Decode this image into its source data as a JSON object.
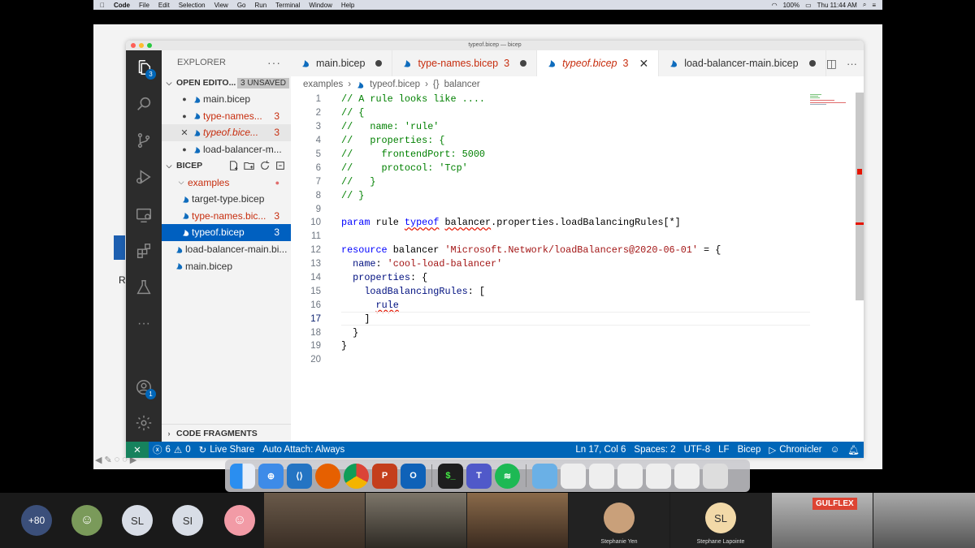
{
  "menubar": {
    "app": "Code",
    "items": [
      "File",
      "Edit",
      "Selection",
      "View",
      "Go",
      "Run",
      "Terminal",
      "Window",
      "Help"
    ],
    "battery": "100%",
    "clock": "Thu 11:44 AM"
  },
  "window": {
    "title": "typeof.bicep — bicep"
  },
  "activity": {
    "explorer_badge": "3",
    "account_badge": "1"
  },
  "sidebar": {
    "title": "EXPLORER",
    "open_editors": {
      "label": "OPEN EDITO...",
      "unsaved": "3 UNSAVED",
      "items": [
        {
          "name": "main.bicep",
          "count": ""
        },
        {
          "name": "type-names...",
          "count": "3"
        },
        {
          "name": "typeof.bice...",
          "count": "3"
        },
        {
          "name": "load-balancer-m...",
          "count": ""
        }
      ]
    },
    "bicep": {
      "label": "BICEP",
      "folder": "examples",
      "files": [
        {
          "name": "target-type.bicep",
          "count": ""
        },
        {
          "name": "type-names.bic...",
          "count": "3"
        },
        {
          "name": "typeof.bicep",
          "count": "3"
        }
      ],
      "root_files": [
        {
          "name": "load-balancer-main.bi..."
        },
        {
          "name": "main.bicep"
        }
      ]
    },
    "fragments": "CODE FRAGMENTS"
  },
  "tabs": [
    {
      "label": "main.bicep",
      "count": ""
    },
    {
      "label": "type-names.bicep",
      "count": "3"
    },
    {
      "label": "typeof.bicep",
      "count": "3"
    },
    {
      "label": "load-balancer-main.bicep",
      "count": ""
    }
  ],
  "breadcrumb": {
    "folder": "examples",
    "file": "typeof.bicep",
    "symbol": "balancer"
  },
  "code": {
    "line_numbers": [
      "1",
      "2",
      "3",
      "4",
      "5",
      "6",
      "7",
      "8",
      "9",
      "10",
      "11",
      "12",
      "13",
      "14",
      "15",
      "16",
      "17",
      "18",
      "19",
      "20"
    ],
    "c1": "// A rule looks like ....",
    "c2": "// {",
    "c3": "//   name: 'rule'",
    "c4": "//   properties: {",
    "c5": "//     frontendPort: 5000",
    "c6": "//     protocol: 'Tcp'",
    "c7": "//   }",
    "c8": "// }",
    "kw_param": "param",
    "id_rule": "rule",
    "kw_typeof": "typeof",
    "expr_balancer": "balancer",
    "expr_rest": ".properties.loadBalancingRules[*]",
    "kw_resource": "resource",
    "id_balancer": "balancer",
    "type_str": "'Microsoft.Network/loadBalancers@2020-06-01'",
    "eq_brace": " = {",
    "prop_name": "name",
    "val_name": "'cool-load-balancer'",
    "prop_properties": "properties",
    "brace_open": ": {",
    "prop_lbr": "loadBalancingRules",
    "bracket_open": ": [",
    "val_rule": "rule",
    "bracket_close": "]",
    "brace_close_inner": "}",
    "brace_close_outer": "}",
    "colon": ": "
  },
  "statusbar": {
    "errors": "6",
    "warnings": "0",
    "live_share": "Live Share",
    "auto_attach": "Auto Attach: Always",
    "position": "Ln 17, Col 6",
    "spaces": "Spaces: 2",
    "encoding": "UTF-8",
    "eol": "LF",
    "language": "Bicep",
    "chronicler": "Chronicler"
  },
  "zoom": {
    "more": "+80",
    "initials": [
      "SL",
      "SI"
    ],
    "names": [
      "Stephanie Yen",
      "Stephane Lapointe"
    ],
    "sl_initials": "SL",
    "banner": "GULFLEX"
  },
  "colors": {
    "accent": "#0066b8",
    "selection": "#0060c0",
    "error": "#e51400",
    "comment": "#008000",
    "keyword": "#0000ff",
    "string": "#a31515"
  }
}
